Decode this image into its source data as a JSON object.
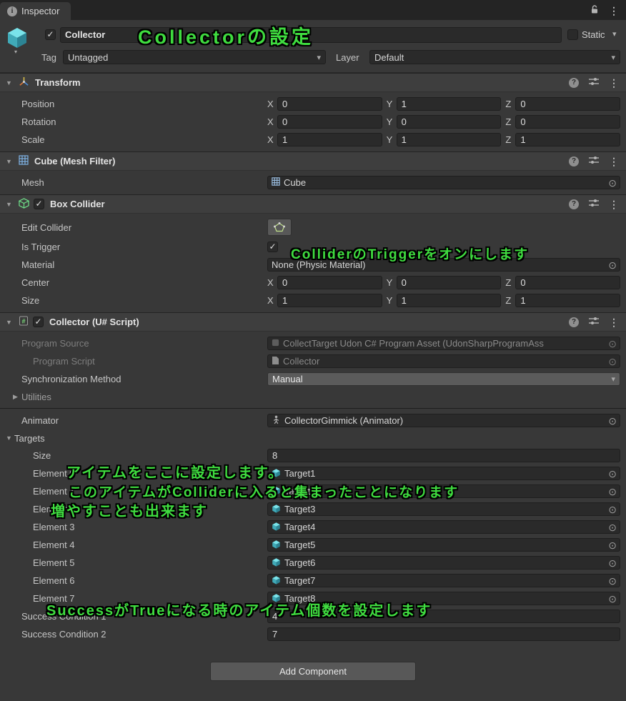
{
  "tab": {
    "title": "Inspector"
  },
  "icons": {
    "kebab": "⋮",
    "picker": "⊙",
    "foldout_open": "▼",
    "foldout_closed": "▶",
    "dropdown": "▾",
    "check": "✓",
    "help": "?",
    "info": "i",
    "small_arrow": "▾"
  },
  "gameobject": {
    "name": "Collector",
    "static_label": "Static",
    "tag_label": "Tag",
    "tag_value": "Untagged",
    "layer_label": "Layer",
    "layer_value": "Default"
  },
  "axes": {
    "x": "X",
    "y": "Y",
    "z": "Z"
  },
  "transform": {
    "title": "Transform",
    "position": {
      "label": "Position",
      "x": "0",
      "y": "1",
      "z": "0"
    },
    "rotation": {
      "label": "Rotation",
      "x": "0",
      "y": "0",
      "z": "0"
    },
    "scale": {
      "label": "Scale",
      "x": "1",
      "y": "1",
      "z": "1"
    }
  },
  "mesh_filter": {
    "title": "Cube (Mesh Filter)",
    "mesh_label": "Mesh",
    "mesh_value": "Cube"
  },
  "box_collider": {
    "title": "Box Collider",
    "edit_collider_label": "Edit Collider",
    "is_trigger_label": "Is Trigger",
    "material_label": "Material",
    "material_value": "None (Physic Material)",
    "center": {
      "label": "Center",
      "x": "0",
      "y": "0",
      "z": "0"
    },
    "size": {
      "label": "Size",
      "x": "1",
      "y": "1",
      "z": "1"
    }
  },
  "collector": {
    "title": "Collector (U# Script)",
    "program_source_label": "Program Source",
    "program_source_value": "CollectTarget Udon C# Program Asset (UdonSharpProgramAss",
    "program_script_label": "Program Script",
    "program_script_value": "Collector",
    "sync_label": "Synchronization Method",
    "sync_value": "Manual",
    "utilities_label": "Utilities",
    "animator_label": "Animator",
    "animator_value": "CollectorGimmick (Animator)",
    "targets_label": "Targets",
    "size_label": "Size",
    "size_value": "8",
    "elements": [
      {
        "label": "Element 0",
        "value": "Target1"
      },
      {
        "label": "Element 1",
        "value": "Target2"
      },
      {
        "label": "Element 2",
        "value": "Target3"
      },
      {
        "label": "Element 3",
        "value": "Target4"
      },
      {
        "label": "Element 4",
        "value": "Target5"
      },
      {
        "label": "Element 5",
        "value": "Target6"
      },
      {
        "label": "Element 6",
        "value": "Target7"
      },
      {
        "label": "Element 7",
        "value": "Target8"
      }
    ],
    "success1_label": "Success Condition 1",
    "success1_value": "4",
    "success2_label": "Success Condition 2",
    "success2_value": "7"
  },
  "add_component_label": "Add Component",
  "annotations": [
    "Collectorの設定",
    "ColliderのTriggerをオンにします",
    "アイテムをここに設定します。",
    "このアイテムがColliderに入ると集まったことになります",
    "増やすことも出来ます",
    "SuccessがTrueになる時のアイテム個数を設定します"
  ],
  "colors": {
    "annotation_green": "#3fdc3f",
    "gameobject_icon_teal": "#5fd3dd",
    "collider_icon_green": "#6fe089",
    "mesh_icon_blue": "#7fb3e6"
  }
}
